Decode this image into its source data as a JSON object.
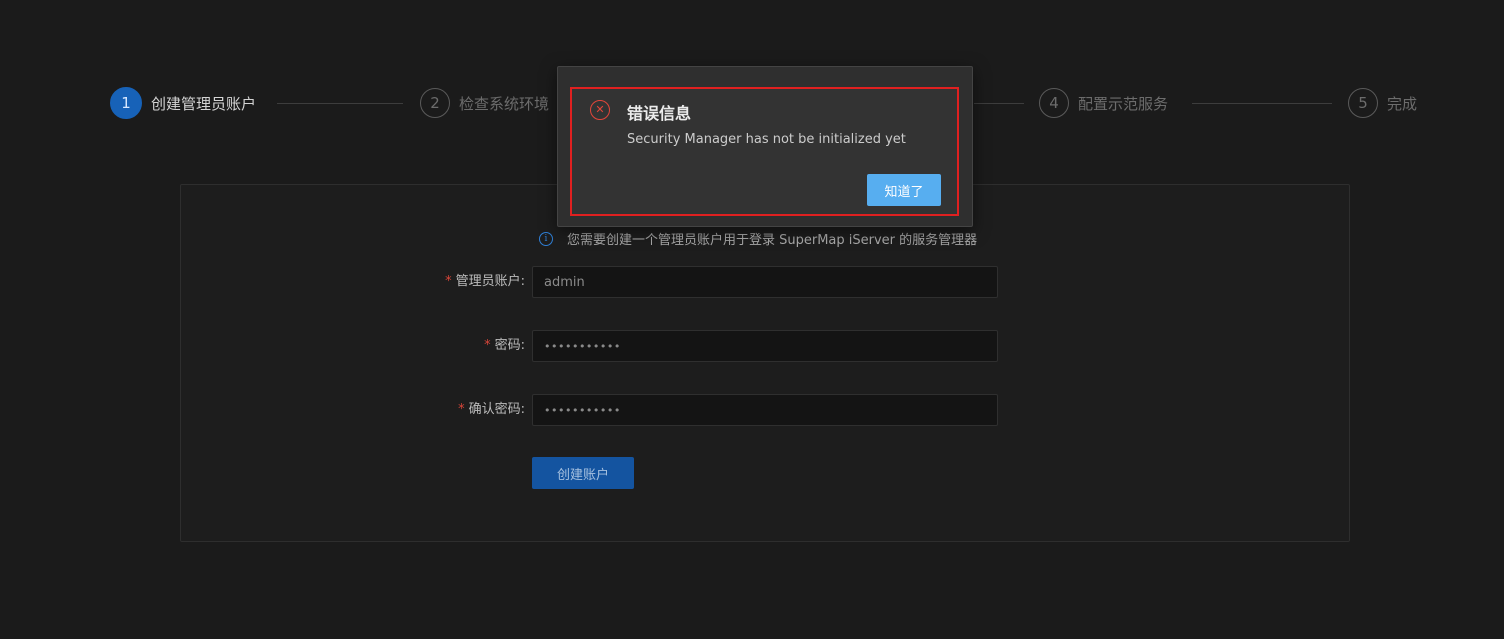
{
  "steps": [
    {
      "number": "1",
      "label": "创建管理员账户"
    },
    {
      "number": "2",
      "label": "检查系统环境"
    },
    {
      "number": "4",
      "label": "配置示范服务"
    },
    {
      "number": "5",
      "label": "完成"
    }
  ],
  "form": {
    "notice": "您需要创建一个管理员账户用于登录 SuperMap iServer 的服务管理器",
    "required_mark": "*",
    "fields": [
      {
        "label": "管理员账户:",
        "value": "admin"
      },
      {
        "label": "密码:",
        "value": "•••••••••••"
      },
      {
        "label": "确认密码:",
        "value": "•••••••••••"
      }
    ],
    "submit_label": "创建账户"
  },
  "dialog": {
    "title": "错误信息",
    "message": "Security Manager has not be initialized yet",
    "ok_label": "知道了"
  },
  "colors": {
    "accent": "#1762b8",
    "dialog_button": "#57aef0",
    "error": "#e2463a",
    "highlight": "#e02020"
  }
}
